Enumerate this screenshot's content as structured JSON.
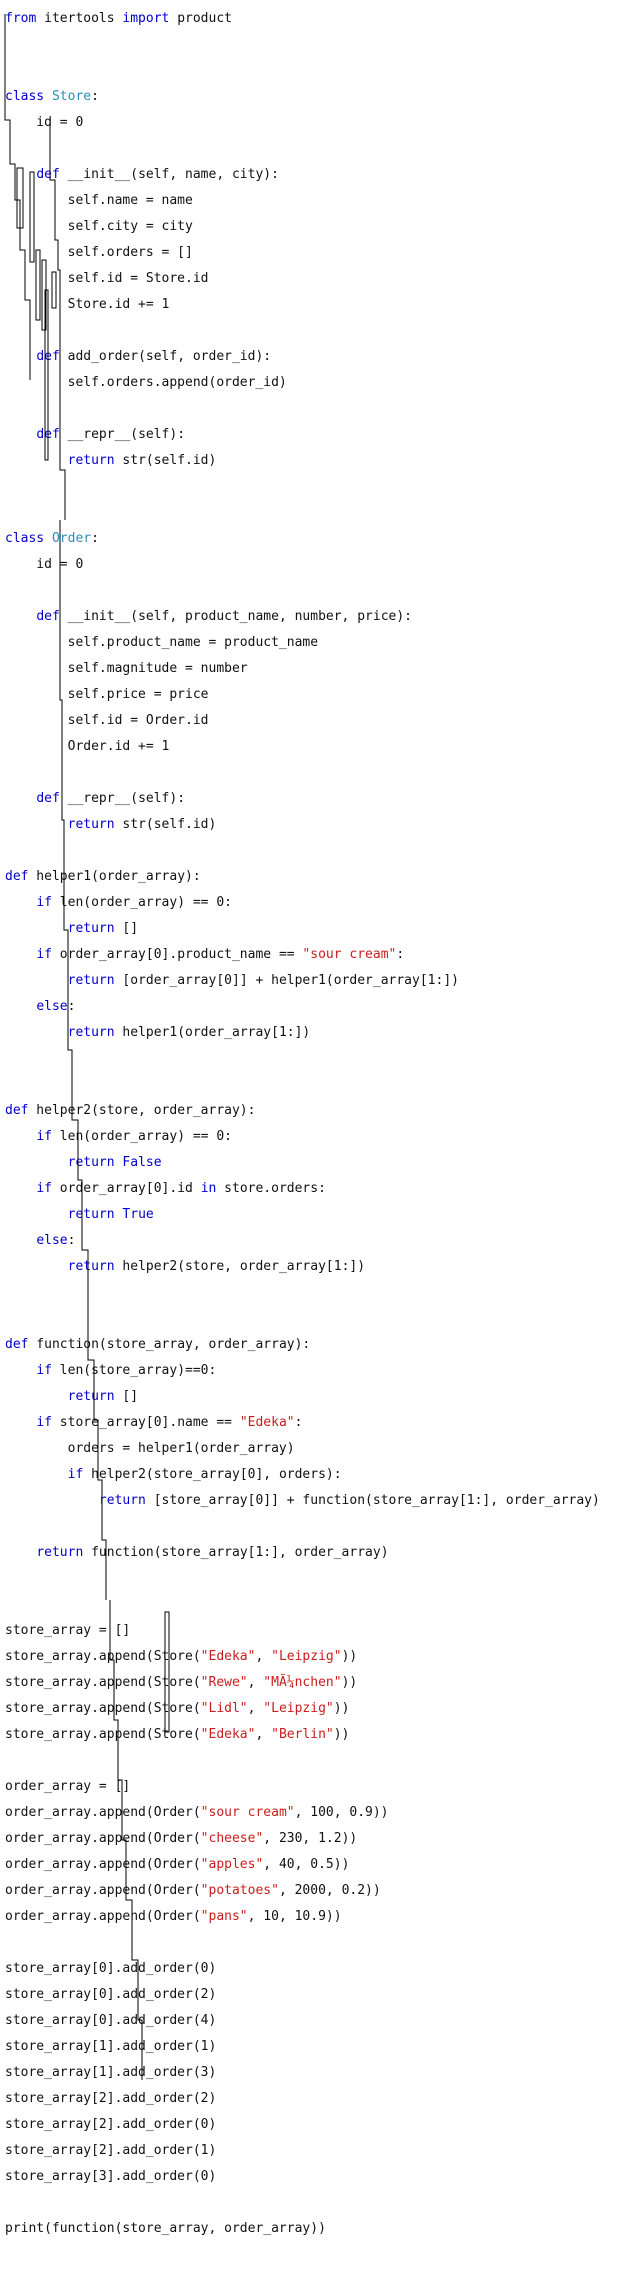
{
  "editor": {
    "colors": {
      "keyword": "#0000cc",
      "class_name": "#2a8fb8",
      "string": "#c81e1e",
      "text": "#111111",
      "background": "#ffffff"
    },
    "lines": [
      [
        {
          "t": "from",
          "c": "kw"
        },
        {
          "t": " itertools ",
          "c": "fn"
        },
        {
          "t": "import",
          "c": "kw"
        },
        {
          "t": " product",
          "c": "fn"
        }
      ],
      [],
      [],
      [
        {
          "t": "class",
          "c": "kw"
        },
        {
          "t": " ",
          "c": "fn"
        },
        {
          "t": "Store",
          "c": "cls"
        },
        {
          "t": ":",
          "c": "fn"
        }
      ],
      [
        {
          "t": "    id = 0",
          "c": "fn"
        }
      ],
      [],
      [
        {
          "t": "    ",
          "c": "fn"
        },
        {
          "t": "def",
          "c": "kw"
        },
        {
          "t": " __init__(self, name, city):",
          "c": "fn"
        }
      ],
      [
        {
          "t": "        self.name = name",
          "c": "fn"
        }
      ],
      [
        {
          "t": "        self.city = city",
          "c": "fn"
        }
      ],
      [
        {
          "t": "        self.orders = []",
          "c": "fn"
        }
      ],
      [
        {
          "t": "        self.id = Store.id",
          "c": "fn"
        }
      ],
      [
        {
          "t": "        Store.id += 1",
          "c": "fn"
        }
      ],
      [],
      [
        {
          "t": "    ",
          "c": "fn"
        },
        {
          "t": "def",
          "c": "kw"
        },
        {
          "t": " add_order(self, order_id):",
          "c": "fn"
        }
      ],
      [
        {
          "t": "        self.orders.append(order_id)",
          "c": "fn"
        }
      ],
      [],
      [
        {
          "t": "    ",
          "c": "fn"
        },
        {
          "t": "def",
          "c": "kw"
        },
        {
          "t": " __repr__(self):",
          "c": "fn"
        }
      ],
      [
        {
          "t": "        ",
          "c": "fn"
        },
        {
          "t": "return",
          "c": "kw"
        },
        {
          "t": " str(self.id)",
          "c": "fn"
        }
      ],
      [],
      [],
      [
        {
          "t": "class",
          "c": "kw"
        },
        {
          "t": " ",
          "c": "fn"
        },
        {
          "t": "Order",
          "c": "cls"
        },
        {
          "t": ":",
          "c": "fn"
        }
      ],
      [
        {
          "t": "    id = 0",
          "c": "fn"
        }
      ],
      [],
      [
        {
          "t": "    ",
          "c": "fn"
        },
        {
          "t": "def",
          "c": "kw"
        },
        {
          "t": " __init__(self, product_name, number, price):",
          "c": "fn"
        }
      ],
      [
        {
          "t": "        self.product_name = product_name",
          "c": "fn"
        }
      ],
      [
        {
          "t": "        self.magnitude = number",
          "c": "fn"
        }
      ],
      [
        {
          "t": "        self.price = price",
          "c": "fn"
        }
      ],
      [
        {
          "t": "        self.id = Order.id",
          "c": "fn"
        }
      ],
      [
        {
          "t": "        Order.id += 1",
          "c": "fn"
        }
      ],
      [],
      [
        {
          "t": "    ",
          "c": "fn"
        },
        {
          "t": "def",
          "c": "kw"
        },
        {
          "t": " __repr__(self):",
          "c": "fn"
        }
      ],
      [
        {
          "t": "        ",
          "c": "fn"
        },
        {
          "t": "return",
          "c": "kw"
        },
        {
          "t": " str(self.id)",
          "c": "fn"
        }
      ],
      [],
      [
        {
          "t": "def",
          "c": "kw"
        },
        {
          "t": " helper1(order_array):",
          "c": "fn"
        }
      ],
      [
        {
          "t": "    ",
          "c": "fn"
        },
        {
          "t": "if",
          "c": "kw"
        },
        {
          "t": " len(order_array) == 0:",
          "c": "fn"
        }
      ],
      [
        {
          "t": "        ",
          "c": "fn"
        },
        {
          "t": "return",
          "c": "kw"
        },
        {
          "t": " []",
          "c": "fn"
        }
      ],
      [
        {
          "t": "    ",
          "c": "fn"
        },
        {
          "t": "if",
          "c": "kw"
        },
        {
          "t": " order_array[0].product_name == ",
          "c": "fn"
        },
        {
          "t": "\"sour cream\"",
          "c": "str"
        },
        {
          "t": ":",
          "c": "fn"
        }
      ],
      [
        {
          "t": "        ",
          "c": "fn"
        },
        {
          "t": "return",
          "c": "kw"
        },
        {
          "t": " [order_array[0]] + helper1(order_array[1:])",
          "c": "fn"
        }
      ],
      [
        {
          "t": "    ",
          "c": "fn"
        },
        {
          "t": "else",
          "c": "kw"
        },
        {
          "t": ":",
          "c": "fn"
        }
      ],
      [
        {
          "t": "        ",
          "c": "fn"
        },
        {
          "t": "return",
          "c": "kw"
        },
        {
          "t": " helper1(order_array[1:])",
          "c": "fn"
        }
      ],
      [],
      [],
      [
        {
          "t": "def",
          "c": "kw"
        },
        {
          "t": " helper2(store, order_array):",
          "c": "fn"
        }
      ],
      [
        {
          "t": "    ",
          "c": "fn"
        },
        {
          "t": "if",
          "c": "kw"
        },
        {
          "t": " len(order_array) == 0:",
          "c": "fn"
        }
      ],
      [
        {
          "t": "        ",
          "c": "fn"
        },
        {
          "t": "return",
          "c": "kw"
        },
        {
          "t": " ",
          "c": "fn"
        },
        {
          "t": "False",
          "c": "kw"
        }
      ],
      [
        {
          "t": "    ",
          "c": "fn"
        },
        {
          "t": "if",
          "c": "kw"
        },
        {
          "t": " order_array[0].id ",
          "c": "fn"
        },
        {
          "t": "in",
          "c": "kw"
        },
        {
          "t": " store.orders:",
          "c": "fn"
        }
      ],
      [
        {
          "t": "        ",
          "c": "fn"
        },
        {
          "t": "return",
          "c": "kw"
        },
        {
          "t": " ",
          "c": "fn"
        },
        {
          "t": "True",
          "c": "kw"
        }
      ],
      [
        {
          "t": "    ",
          "c": "fn"
        },
        {
          "t": "else",
          "c": "kw"
        },
        {
          "t": ":",
          "c": "fn"
        }
      ],
      [
        {
          "t": "        ",
          "c": "fn"
        },
        {
          "t": "return",
          "c": "kw"
        },
        {
          "t": " helper2(store, order_array[1:])",
          "c": "fn"
        }
      ],
      [],
      [],
      [
        {
          "t": "def",
          "c": "kw"
        },
        {
          "t": " function(store_array, order_array):",
          "c": "fn"
        }
      ],
      [
        {
          "t": "    ",
          "c": "fn"
        },
        {
          "t": "if",
          "c": "kw"
        },
        {
          "t": " len(store_array)==0:",
          "c": "fn"
        }
      ],
      [
        {
          "t": "        ",
          "c": "fn"
        },
        {
          "t": "return",
          "c": "kw"
        },
        {
          "t": " []",
          "c": "fn"
        }
      ],
      [
        {
          "t": "    ",
          "c": "fn"
        },
        {
          "t": "if",
          "c": "kw"
        },
        {
          "t": " store_array[0].name == ",
          "c": "fn"
        },
        {
          "t": "\"Edeka\"",
          "c": "str"
        },
        {
          "t": ":",
          "c": "fn"
        }
      ],
      [
        {
          "t": "        orders = helper1(order_array)",
          "c": "fn"
        }
      ],
      [
        {
          "t": "        ",
          "c": "fn"
        },
        {
          "t": "if",
          "c": "kw"
        },
        {
          "t": " helper2(store_array[0], orders):",
          "c": "fn"
        }
      ],
      [
        {
          "t": "            ",
          "c": "fn"
        },
        {
          "t": "return",
          "c": "kw"
        },
        {
          "t": " [store_array[0]] + function(store_array[1:], order_array)",
          "c": "fn"
        }
      ],
      [],
      [
        {
          "t": "    ",
          "c": "fn"
        },
        {
          "t": "return",
          "c": "kw"
        },
        {
          "t": " function(store_array[1:], order_array)",
          "c": "fn"
        }
      ],
      [],
      [],
      [
        {
          "t": "store_array = []",
          "c": "fn"
        }
      ],
      [
        {
          "t": "store_array.append(Store(",
          "c": "fn"
        },
        {
          "t": "\"Edeka\"",
          "c": "str"
        },
        {
          "t": ", ",
          "c": "fn"
        },
        {
          "t": "\"Leipzig\"",
          "c": "str"
        },
        {
          "t": "))",
          "c": "fn"
        }
      ],
      [
        {
          "t": "store_array.append(Store(",
          "c": "fn"
        },
        {
          "t": "\"Rewe\"",
          "c": "str"
        },
        {
          "t": ", ",
          "c": "fn"
        },
        {
          "t": "\"MÃ¼nchen\"",
          "c": "str"
        },
        {
          "t": "))",
          "c": "fn"
        }
      ],
      [
        {
          "t": "store_array.append(Store(",
          "c": "fn"
        },
        {
          "t": "\"Lidl\"",
          "c": "str"
        },
        {
          "t": ", ",
          "c": "fn"
        },
        {
          "t": "\"Leipzig\"",
          "c": "str"
        },
        {
          "t": "))",
          "c": "fn"
        }
      ],
      [
        {
          "t": "store_array.append(Store(",
          "c": "fn"
        },
        {
          "t": "\"Edeka\"",
          "c": "str"
        },
        {
          "t": ", ",
          "c": "fn"
        },
        {
          "t": "\"Berlin\"",
          "c": "str"
        },
        {
          "t": "))",
          "c": "fn"
        }
      ],
      [],
      [
        {
          "t": "order_array = []",
          "c": "fn"
        }
      ],
      [
        {
          "t": "order_array.append(Order(",
          "c": "fn"
        },
        {
          "t": "\"sour cream\"",
          "c": "str"
        },
        {
          "t": ", 100, 0.9))",
          "c": "fn"
        }
      ],
      [
        {
          "t": "order_array.append(Order(",
          "c": "fn"
        },
        {
          "t": "\"cheese\"",
          "c": "str"
        },
        {
          "t": ", 230, 1.2))",
          "c": "fn"
        }
      ],
      [
        {
          "t": "order_array.append(Order(",
          "c": "fn"
        },
        {
          "t": "\"apples\"",
          "c": "str"
        },
        {
          "t": ", 40, 0.5))",
          "c": "fn"
        }
      ],
      [
        {
          "t": "order_array.append(Order(",
          "c": "fn"
        },
        {
          "t": "\"potatoes\"",
          "c": "str"
        },
        {
          "t": ", 2000, 0.2))",
          "c": "fn"
        }
      ],
      [
        {
          "t": "order_array.append(Order(",
          "c": "fn"
        },
        {
          "t": "\"pans\"",
          "c": "str"
        },
        {
          "t": ", 10, 10.9))",
          "c": "fn"
        }
      ],
      [],
      [
        {
          "t": "store_array[0].add_order(0)",
          "c": "fn"
        }
      ],
      [
        {
          "t": "store_array[0].add_order(2)",
          "c": "fn"
        }
      ],
      [
        {
          "t": "store_array[0].add_order(4)",
          "c": "fn"
        }
      ],
      [
        {
          "t": "store_array[1].add_order(1)",
          "c": "fn"
        }
      ],
      [
        {
          "t": "store_array[1].add_order(3)",
          "c": "fn"
        }
      ],
      [
        {
          "t": "store_array[2].add_order(2)",
          "c": "fn"
        }
      ],
      [
        {
          "t": "store_array[2].add_order(0)",
          "c": "fn"
        }
      ],
      [
        {
          "t": "store_array[2].add_order(1)",
          "c": "fn"
        }
      ],
      [
        {
          "t": "store_array[3].add_order(0)",
          "c": "fn"
        }
      ],
      [],
      [
        {
          "t": "print(function(store_array, order_array))",
          "c": "fn"
        }
      ]
    ]
  }
}
